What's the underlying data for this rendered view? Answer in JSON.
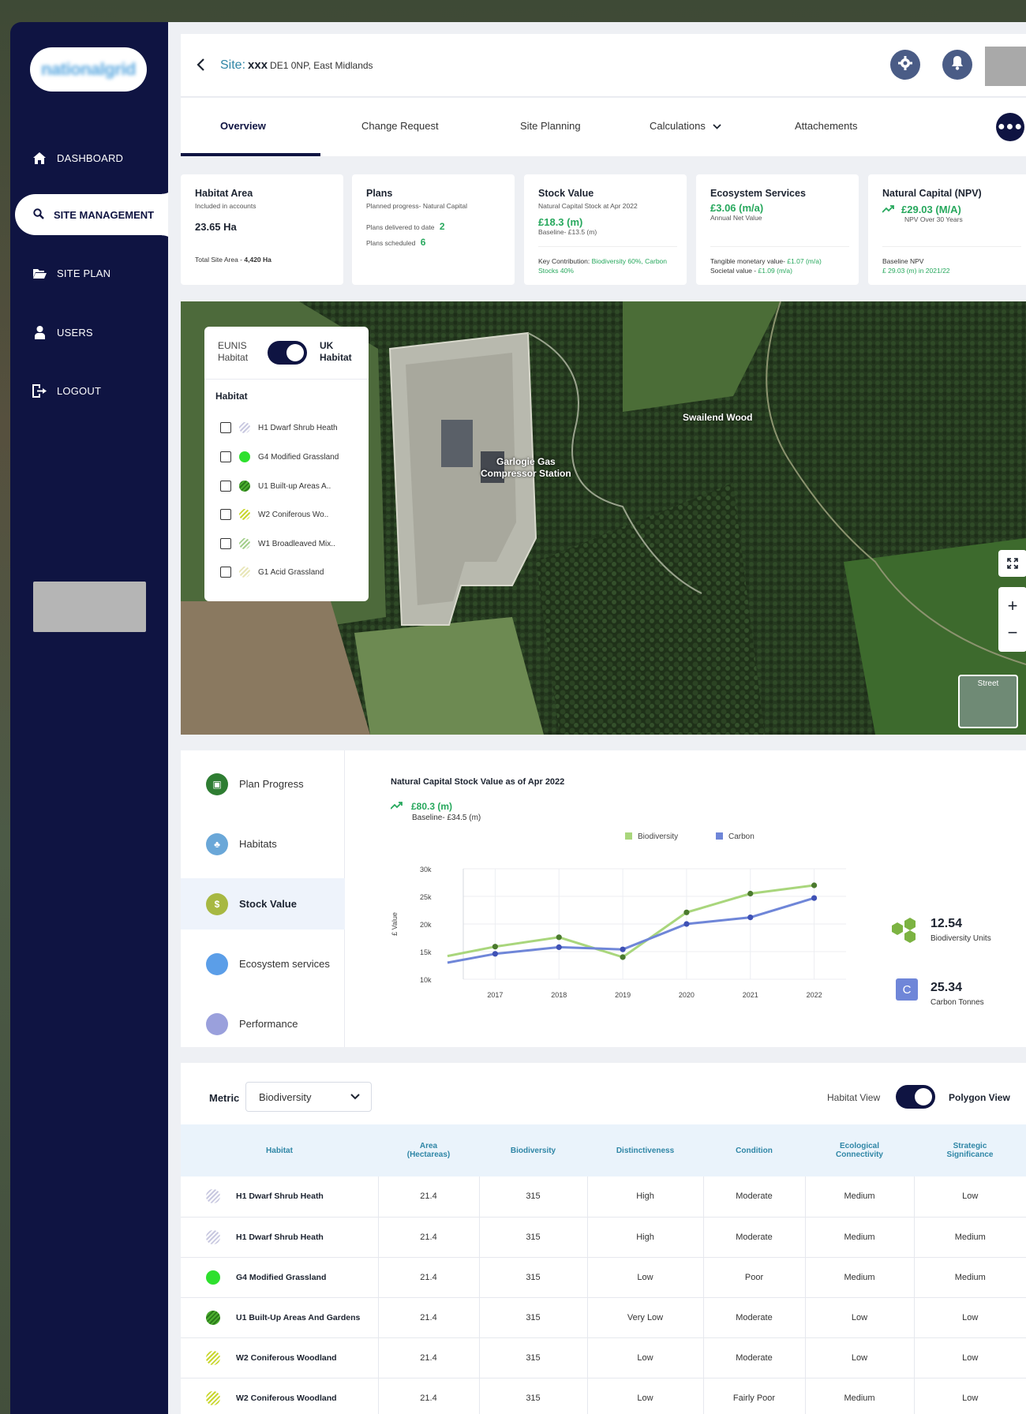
{
  "brand": {
    "logo_text": "nationalgrid"
  },
  "sidebar": {
    "items": [
      {
        "label": "DASHBOARD",
        "icon": "home-icon"
      },
      {
        "label": "SITE MANAGEMENT",
        "icon": "search-icon"
      },
      {
        "label": "SITE PLAN",
        "icon": "folder-open-icon"
      },
      {
        "label": "USERS",
        "icon": "user-icon"
      },
      {
        "label": "LOGOUT",
        "icon": "logout-icon"
      }
    ],
    "active": "SITE MANAGEMENT"
  },
  "header": {
    "site_label": "Site:",
    "site_name": "xxx",
    "site_address": "DE1 0NP, East Midlands"
  },
  "tabs": [
    {
      "label": "Overview",
      "active": true
    },
    {
      "label": "Change Request"
    },
    {
      "label": "Site Planning"
    },
    {
      "label": "Calculations"
    },
    {
      "label": "Attachements"
    }
  ],
  "cards": {
    "habitat_area": {
      "title": "Habitat Area",
      "subtitle": "Included in accounts",
      "value": "23.65 Ha",
      "foot_label": "Total Site Area - ",
      "foot_value": "4,420 Ha"
    },
    "plans": {
      "title": "Plans",
      "subtitle": "Planned progress- Natural Capital",
      "delivered_label": "Plans delivered to date",
      "delivered_value": "2",
      "scheduled_label": "Plans scheduled",
      "scheduled_value": "6"
    },
    "stock_value": {
      "title": "Stock Value",
      "subtitle": "Natural Capital Stock at Apr 2022",
      "value": "£18.3 (m)",
      "baseline": "Baseline- £13.5 (m)",
      "foot_label": "Key Contribution: ",
      "foot_value": "Biodiversity 60%, Carbon Stocks 40%"
    },
    "ecosystem": {
      "title": "Ecosystem Services",
      "value": "£3.06 (m/a)",
      "subtitle": "Annual Net Value",
      "foot1_label": "Tangible monetary value- ",
      "foot1_value": "£1.07 (m/a)",
      "foot2_label": "Societal value - ",
      "foot2_value": "£1.09 (m/a)"
    },
    "npv": {
      "title": "Natural Capital (NPV)",
      "value": "£29.03 (M/A)",
      "subtitle": "NPV Over 30 Years",
      "foot_label": "Baseline NPV",
      "foot_value": "£ 29.03 (m) in 2021/22"
    }
  },
  "map": {
    "toggle_left": "EUNIS Habitat",
    "toggle_right": "UK Habitat",
    "habitat_heading": "Habitat",
    "habitats": [
      {
        "label": "H1 Dwarf Shrub Heath",
        "swatch": "#c9c9e0"
      },
      {
        "label": "G4 Modified Grassland",
        "swatch": "#2ee02e"
      },
      {
        "label": "U1 Built-up Areas A..",
        "swatch": "#4caf2f"
      },
      {
        "label": "W2 Coniferous Wo..",
        "swatch": "#c9d62e"
      },
      {
        "label": "W1 Broadleaved Mix..",
        "swatch": "#a4cf8d"
      },
      {
        "label": "G1 Acid Grassland",
        "swatch": "#e8e6b8"
      }
    ],
    "labels": {
      "station": "Garlogie Gas\nCompressor Station",
      "wood": "Swailend Wood"
    },
    "street_label": "Street"
  },
  "stock_nav": [
    {
      "label": "Plan Progress",
      "color": "#2e7d32"
    },
    {
      "label": "Habitats",
      "color": "#6aa7d8"
    },
    {
      "label": "Stock Value",
      "color": "#a7b842",
      "active": true
    },
    {
      "label": "Ecosystem services",
      "color": "#5b9ee8"
    },
    {
      "label": "Performance",
      "color": "#9aa0dc"
    }
  ],
  "chart_summary": {
    "title": "Natural Capital Stock Value as of Apr 2022",
    "value": "£80.3 (m)",
    "baseline": "Baseline- £34.5 (m)",
    "bio_units": "12.54",
    "bio_units_label": "Biodiversity Units",
    "carbon_tonnes": "25.34",
    "carbon_tonnes_label": "Carbon Tonnes",
    "carbon_badge": "C"
  },
  "chart_data": {
    "type": "line",
    "title": "Natural Capital Stock Value as of Apr 2022",
    "ylabel": "£ Value",
    "xlabel": "",
    "ylim": [
      10000,
      30000
    ],
    "yticks": [
      "10k",
      "15k",
      "20k",
      "25k",
      "30k"
    ],
    "x": [
      "2017",
      "2018",
      "2019",
      "2020",
      "2021",
      "2022"
    ],
    "series": [
      {
        "name": "Biodiversity",
        "color": "#a9d67c",
        "start": 14200,
        "values": [
          15900,
          17600,
          14000,
          22100,
          25500,
          27000
        ]
      },
      {
        "name": "Carbon",
        "color": "#6f86d8",
        "start": 13000,
        "values": [
          14600,
          15800,
          15400,
          20000,
          21200,
          24700
        ]
      }
    ],
    "legend": "top"
  },
  "table": {
    "metric_label": "Metric",
    "metric_value": "Biodiversity",
    "view_left": "Habitat View",
    "view_right": "Polygon View",
    "headers": [
      "Habitat",
      "Area\n(Hectareas)",
      "Biodiversity",
      "Distinctiveness",
      "Condition",
      "Ecological\nConnectivity",
      "Strategic\nSignificance"
    ],
    "rows": [
      {
        "habitat": "H1 Dwarf Shrub Heath",
        "swatch": "#c9c9e0",
        "area": "21.4",
        "bio": "315",
        "dist": "High",
        "cond": "Moderate",
        "eco": "Medium",
        "strat": "Low"
      },
      {
        "habitat": "H1 Dwarf Shrub Heath",
        "swatch": "#c9c9e0",
        "area": "21.4",
        "bio": "315",
        "dist": "High",
        "cond": "Moderate",
        "eco": "Medium",
        "strat": "Medium"
      },
      {
        "habitat": "G4 Modified Grassland",
        "swatch": "#2ee02e",
        "area": "21.4",
        "bio": "315",
        "dist": "Low",
        "cond": "Poor",
        "eco": "Medium",
        "strat": "Medium"
      },
      {
        "habitat": "U1 Built-Up Areas And Gardens",
        "swatch": "#4caf2f",
        "area": "21.4",
        "bio": "315",
        "dist": "Very Low",
        "cond": "Moderate",
        "eco": "Low",
        "strat": "Low"
      },
      {
        "habitat": "W2 Coniferous Woodland",
        "swatch": "#c9d62e",
        "area": "21.4",
        "bio": "315",
        "dist": "Low",
        "cond": "Moderate",
        "eco": "Low",
        "strat": "Low"
      },
      {
        "habitat": "W2 Coniferous Woodland",
        "swatch": "#c9d62e",
        "area": "21.4",
        "bio": "315",
        "dist": "Low",
        "cond": "Fairly Poor",
        "eco": "Medium",
        "strat": "Low"
      }
    ]
  }
}
